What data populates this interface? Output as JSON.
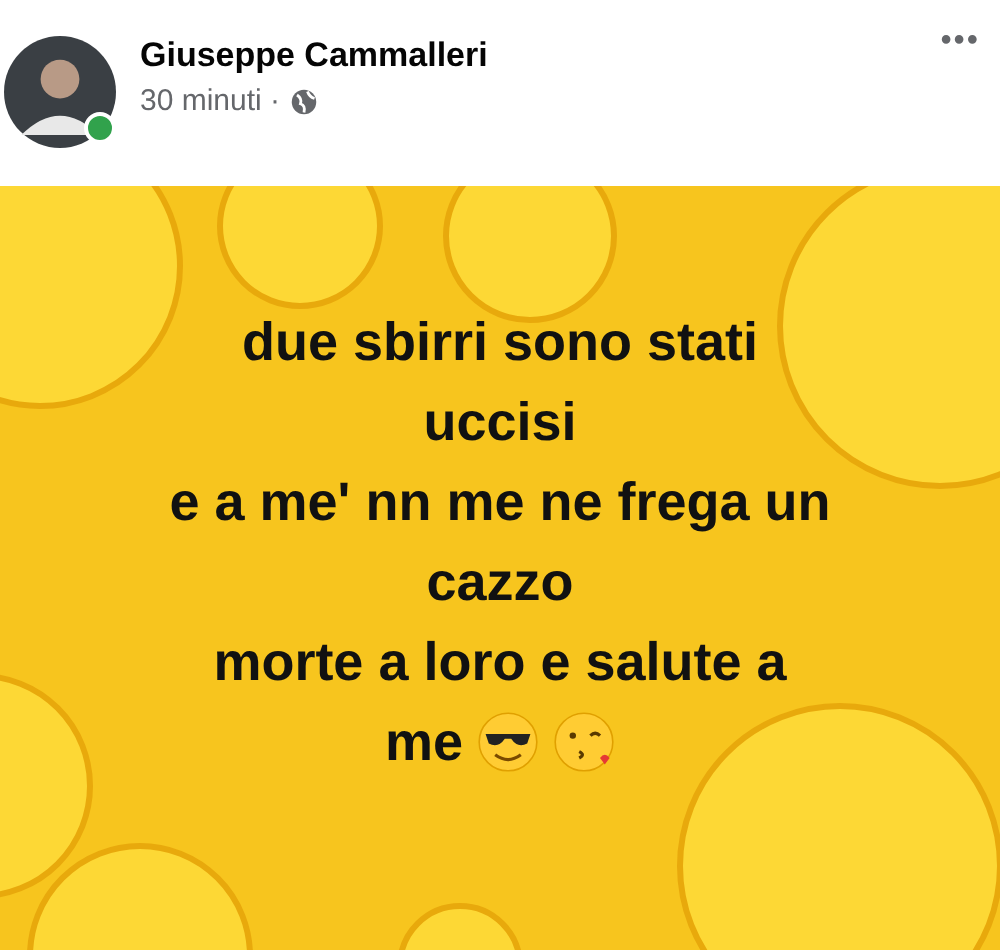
{
  "post": {
    "author": "Giuseppe Cammalleri",
    "online": true,
    "time": "30 minuti ·",
    "more": "•••",
    "image": {
      "lines": [
        "due sbirri sono stati",
        "uccisi",
        "e a me' nn me ne frega un",
        "cazzo",
        "morte a loro e salute a",
        "me"
      ]
    }
  }
}
